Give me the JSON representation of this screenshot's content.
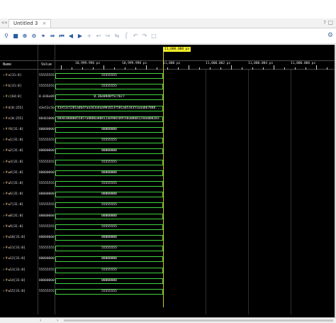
{
  "tabbar": {
    "nav_arrows": "«»",
    "tab_label": "Untitled 3",
    "tab_close": "×",
    "help": "?",
    "restore": "▢"
  },
  "toolbar": {
    "icons": [
      "search-icon",
      "save-icon",
      "zoom-in-icon",
      "zoom-out-icon",
      "zoom-fit-icon",
      "go-to-cursor-icon",
      "first-edge-icon",
      "previous-edge-icon",
      "next-edge-icon",
      "add-marker-icon",
      "previous-marker-icon",
      "next-marker-icon",
      "swap-cursors-icon",
      "snap-icon",
      "collapse-icon",
      "expand-icon",
      "group-icon"
    ],
    "gear_icon": "gear-icon"
  },
  "columns": {
    "name_header": "Name",
    "value_header": "Value"
  },
  "cursor": {
    "time_label": "11,000.000 ps"
  },
  "ruler": {
    "labels": [
      "10,999.996 ps",
      "10,999.998 ps",
      "11,000 ps",
      "11,000.002 ps",
      "11,000.004 ps",
      "11,000.006 ps"
    ]
  },
  "signals": [
    {
      "name": "a[31:0]",
      "value": "55555555",
      "wave": "55555555"
    },
    {
      "name": "b[31:0]",
      "value": "55555555",
      "wave": "55555555"
    },
    {
      "name": "c[64:0]",
      "value": "0.036e09d8...",
      "wave": "0.36e09d8f5c7bc7"
    },
    {
      "name": "d[0:255]",
      "value": "43e53c5b...",
      "wave": "43e53c5281adbd7aa3d3a4aa9816537581a6534351aaab67888..."
    },
    {
      "name": "e[0:255]",
      "value": "884010000...",
      "wave": "884010000855857a8006a80812a6988189558a0800124da008283..."
    },
    {
      "name": "f0[31:0]",
      "value": "00000000",
      "wave": "00000000"
    },
    {
      "name": "w1[31:0]",
      "value": "55555555",
      "wave": "55555555"
    },
    {
      "name": "w2[31:0]",
      "value": "00000000",
      "wave": "00000000"
    },
    {
      "name": "w3[31:0]",
      "value": "55555555",
      "wave": "55555555"
    },
    {
      "name": "w4[31:0]",
      "value": "00000000",
      "wave": "00000000"
    },
    {
      "name": "w5[31:0]",
      "value": "55555555",
      "wave": "55555555"
    },
    {
      "name": "w6[31:0]",
      "value": "00000000",
      "wave": "00000000"
    },
    {
      "name": "w7[31:0]",
      "value": "55555555",
      "wave": "55555555"
    },
    {
      "name": "w8[31:0]",
      "value": "00000000",
      "wave": "00000000"
    },
    {
      "name": "w9[31:0]",
      "value": "55555555",
      "wave": "55555555"
    },
    {
      "name": "w10[31:0]",
      "value": "00000000",
      "wave": "00000000"
    },
    {
      "name": "w11[31:0]",
      "value": "55555555",
      "wave": "55555555"
    },
    {
      "name": "w12[31:0]",
      "value": "00000000",
      "wave": "00000000"
    },
    {
      "name": "w13[31:0]",
      "value": "55555555",
      "wave": "55555555"
    },
    {
      "name": "w14[31:0]",
      "value": "00000000",
      "wave": "00000000"
    },
    {
      "name": "w15[31:0]",
      "value": "55555555",
      "wave": "55555555"
    }
  ],
  "hscroll": {
    "left_arrow": "‹",
    "right_arrow": "›"
  },
  "colors": {
    "bus": "#3fd43f",
    "cursor": "#f2ec2a",
    "background": "#000000"
  }
}
